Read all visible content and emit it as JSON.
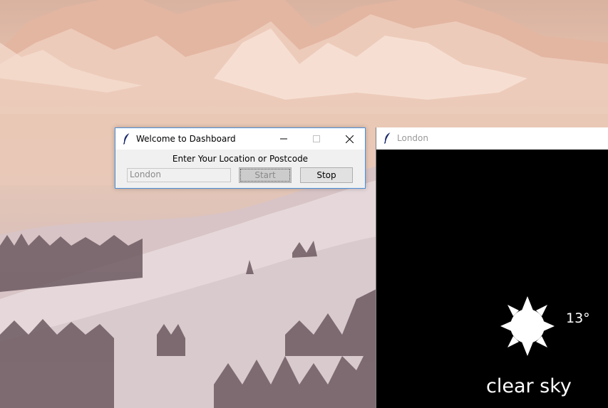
{
  "dashboard": {
    "title": "Welcome to Dashboard",
    "prompt": "Enter Your Location or Postcode",
    "location_value": "London",
    "start_label": "Start",
    "stop_label": "Stop"
  },
  "weather": {
    "title": "London",
    "temperature": "13°",
    "description": "clear sky",
    "icon": "sun-icon"
  },
  "colors": {
    "weather_bg": "#000000",
    "weather_text": "#ffffff",
    "window_bg": "#f0f0f0"
  }
}
